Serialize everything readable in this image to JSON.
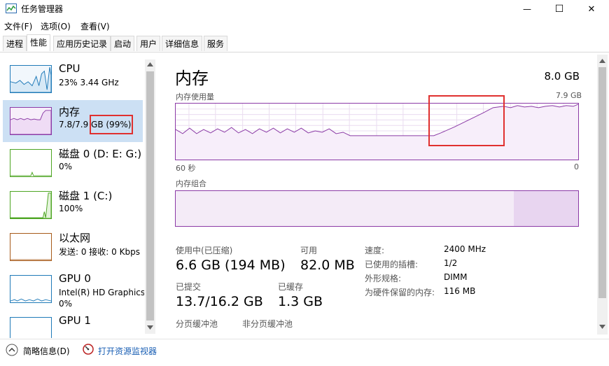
{
  "window": {
    "title": "任务管理器",
    "minimize_glyph": "—",
    "maximize_glyph": "☐",
    "close_glyph": "✕"
  },
  "menu": [
    "文件(F)",
    "选项(O)",
    "查看(V)"
  ],
  "tabs": [
    {
      "label": "进程",
      "active": false
    },
    {
      "label": "性能",
      "active": true
    },
    {
      "label": "应用历史记录",
      "active": false
    },
    {
      "label": "启动",
      "active": false
    },
    {
      "label": "用户",
      "active": false
    },
    {
      "label": "详细信息",
      "active": false
    },
    {
      "label": "服务",
      "active": false
    }
  ],
  "sidebar": {
    "items": [
      {
        "name": "CPU",
        "sub1": "23% 3.44 GHz",
        "color": "#1f7ab8"
      },
      {
        "name": "内存",
        "sub1": "7.8/7.9 GB (99%)",
        "color": "#8b3aa6"
      },
      {
        "name": "磁盘 0 (D: E: G:)",
        "sub1": "0%",
        "color": "#4da522"
      },
      {
        "name": "磁盘 1 (C:)",
        "sub1": "100%",
        "color": "#4da522"
      },
      {
        "name": "以太网",
        "sub1": "发送: 0 接收: 0 Kbps",
        "color": "#a75a19"
      },
      {
        "name": "GPU 0",
        "sub1": "Intel(R) HD Graphics",
        "sub2": "0%",
        "color": "#1f7ab8"
      },
      {
        "name": "GPU 1",
        "color": "#1f7ab8"
      }
    ]
  },
  "main": {
    "title": "内存",
    "total": "8.0 GB",
    "usage_label": "内存使用量",
    "usage_max": "7.9 GB",
    "time_left": "60 秒",
    "time_right": "0",
    "composition_label": "内存组合",
    "composition_in_use_fraction": 0.84,
    "stats": {
      "in_use_label": "使用中(已压缩)",
      "in_use_value": "6.6 GB (194 MB)",
      "available_label": "可用",
      "available_value": "82.0 MB",
      "committed_label": "已提交",
      "committed_value": "13.7/16.2 GB",
      "cached_label": "已缓存",
      "cached_value": "1.3 GB",
      "paged_label": "分页缓冲池",
      "nonpaged_label": "非分页缓冲池"
    },
    "specs": [
      {
        "label": "速度:",
        "value": "2400 MHz"
      },
      {
        "label": "已使用的插槽:",
        "value": "1/2"
      },
      {
        "label": "外形规格:",
        "value": "DIMM"
      },
      {
        "label": "为硬件保留的内存:",
        "value": "116 MB"
      }
    ]
  },
  "bottom": {
    "brief_label": "简略信息(D)",
    "monitor_label": "打开资源监视器"
  },
  "colors": {
    "memory": "#8b3aa6",
    "highlight": "#e0302f",
    "selected": "#cce0f4"
  }
}
